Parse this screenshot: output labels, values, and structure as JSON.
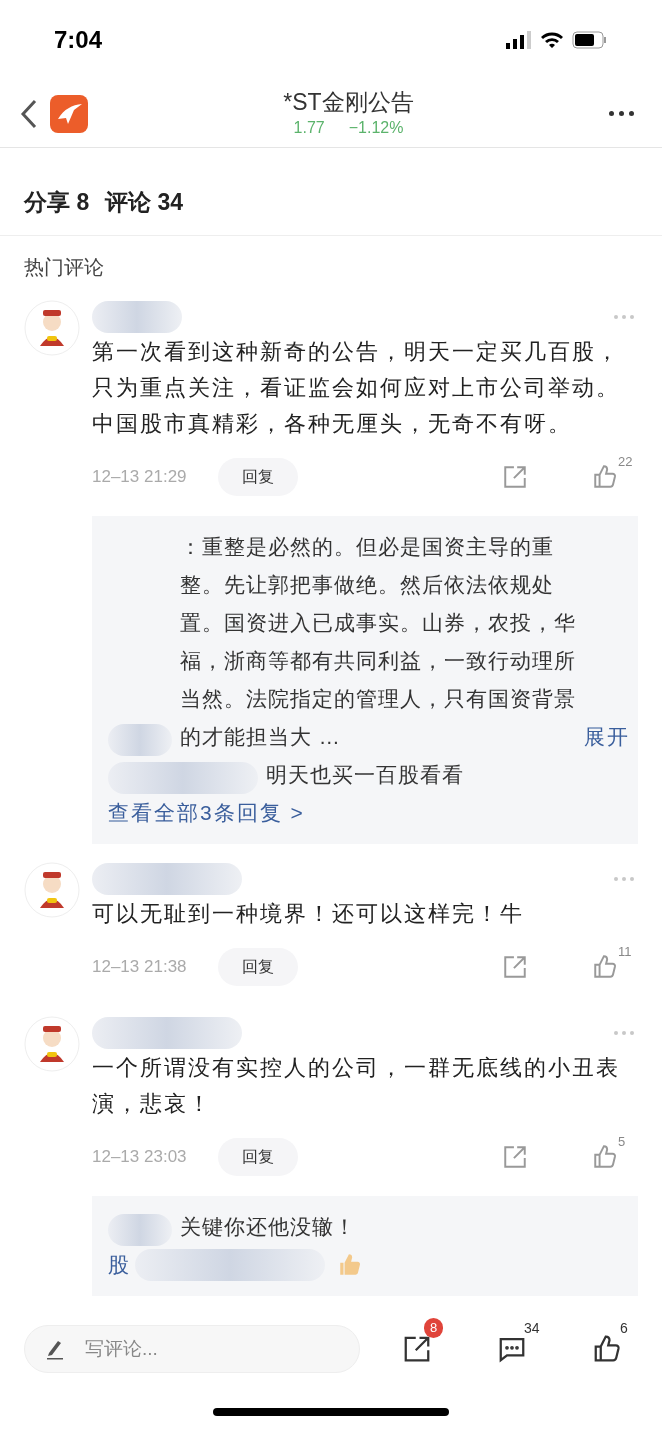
{
  "status_bar": {
    "time": "7:04"
  },
  "nav": {
    "title": "*ST金刚公告",
    "price": "1.77",
    "change": "−1.12%"
  },
  "counts": {
    "share": "分享 8",
    "comment": "评论 34"
  },
  "section_title": "热门评论",
  "comments": [
    {
      "text": "第一次看到这种新奇的公告，明天一定买几百股，只为重点关注，看证监会如何应对上市公司举动。中国股市真精彩，各种无厘头，无奇不有呀。",
      "time": "12–13 21:29",
      "reply_button": "回复",
      "likes": "22",
      "replies": [
        {
          "text": "：重整是必然的。但必是国资主导的重整。先让郭把事做绝。然后依法依规处置。国资进入已成事实。山券，农投，华福，浙商等都有共同利益，一致行动理所当然。法院指定的管理人，只有国资背景的才能担当大 …",
          "expand": "展开"
        },
        {
          "text": "明天也买一百股看看"
        }
      ],
      "view_all": "查看全部3条回复 >"
    },
    {
      "text": "可以无耻到一种境界！还可以这样完！牛",
      "time": "12–13 21:38",
      "reply_button": "回复",
      "likes": "11"
    },
    {
      "text": "一个所谓没有实控人的公司，一群无底线的小丑表演，悲哀！",
      "time": "12–13 23:03",
      "reply_button": "回复",
      "likes": "5",
      "replies": [
        {
          "text": "关键你还他没辙！"
        },
        {
          "text": "股",
          "thumbs": true
        }
      ]
    }
  ],
  "bottom_bar": {
    "placeholder": "写评论...",
    "share_badge": "8",
    "comment_count": "34",
    "like_count": "6"
  }
}
